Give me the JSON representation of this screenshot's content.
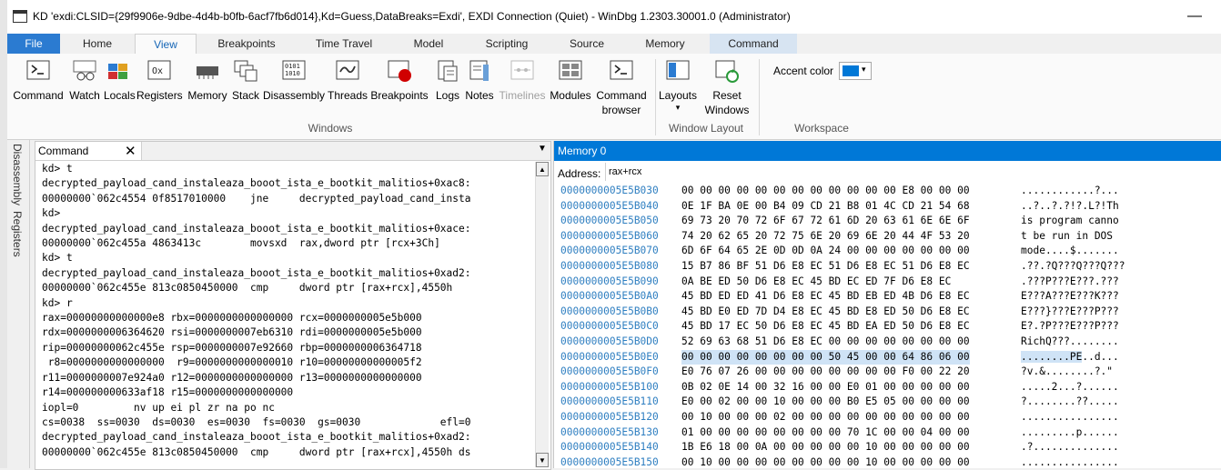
{
  "window": {
    "title": "KD 'exdi:CLSID={29f9906e-9dbe-4d4b-b0fb-6acf7fb6d014},Kd=Guess,DataBreaks=Exdi', EXDI Connection (Quiet) - WinDbg 1.2303.30001.0 (Administrator)",
    "minimize_glyph": "—"
  },
  "ribbon_tabs": [
    "File",
    "Home",
    "View",
    "Breakpoints",
    "Time Travel",
    "Model",
    "Scripting",
    "Source",
    "Memory",
    "Command"
  ],
  "ribbon": {
    "windows_buttons": [
      {
        "label": "Command",
        "icon": "command-window-icon"
      },
      {
        "label": "Watch",
        "icon": "watch-glasses-icon"
      },
      {
        "label": "Locals",
        "icon": "locals-blocks-icon"
      },
      {
        "label": "Registers",
        "icon": "registers-hex-icon"
      },
      {
        "label": "Memory",
        "icon": "memory-chip-icon"
      },
      {
        "label": "Stack",
        "icon": "stack-windows-icon"
      },
      {
        "label": "Disassembly",
        "icon": "disassembly-binary-icon"
      },
      {
        "label": "Threads",
        "icon": "threads-icon"
      },
      {
        "label": "Breakpoints",
        "icon": "breakpoint-red-dot-icon"
      },
      {
        "label": "Logs",
        "icon": "logs-icon"
      },
      {
        "label": "Notes",
        "icon": "notes-icon"
      },
      {
        "label": "Timelines",
        "icon": "timelines-icon"
      },
      {
        "label": "Modules",
        "icon": "modules-grid-icon"
      },
      {
        "label": "Command browser",
        "icon": "command-browser-icon"
      }
    ],
    "windows_group_label": "Windows",
    "layouts_label": "Layouts",
    "layouts_arrow": "▾",
    "reset_label": "Reset Windows",
    "window_layout_label": "Window Layout",
    "accent_label": "Accent color",
    "accent_color": "#0078d7",
    "accent_arrow": "▾",
    "workspace_label": "Workspace"
  },
  "side_tabs": [
    "Disassembly",
    "Registers"
  ],
  "command_pane": {
    "tab_label": "Command",
    "close_glyph": "✕",
    "menu_glyph": "▼",
    "lines": [
      "kd> t",
      "decrypted_payload_cand_instaleaza_booot_ista_e_bootkit_malitios+0xac8:",
      "00000000`062c4554 0f8517010000    jne     decrypted_payload_cand_insta",
      "kd>",
      "decrypted_payload_cand_instaleaza_booot_ista_e_bootkit_malitios+0xace:",
      "00000000`062c455a 4863413c        movsxd  rax,dword ptr [rcx+3Ch]",
      "kd> t",
      "decrypted_payload_cand_instaleaza_booot_ista_e_bootkit_malitios+0xad2:",
      "00000000`062c455e 813c0850450000  cmp     dword ptr [rax+rcx],4550h",
      "kd> r",
      "rax=00000000000000e8 rbx=0000000000000000 rcx=0000000005e5b000",
      "rdx=0000000006364620 rsi=0000000007eb6310 rdi=0000000005e5b000",
      "rip=00000000062c455e rsp=0000000007e92660 rbp=0000000006364718",
      " r8=0000000000000000  r9=0000000000000010 r10=00000000000005f2",
      "r11=0000000007e924a0 r12=0000000000000000 r13=0000000000000000",
      "r14=000000000633af18 r15=0000000000000000",
      "iopl=0         nv up ei pl zr na po nc",
      "cs=0038  ss=0030  ds=0030  es=0030  fs=0030  gs=0030             efl=0",
      "decrypted_payload_cand_instaleaza_booot_ista_e_bootkit_malitios+0xad2:",
      "00000000`062c455e 813c0850450000  cmp     dword ptr [rax+rcx],4550h ds"
    ],
    "scroll_up": "▲",
    "scroll_down": "▼"
  },
  "memory_pane": {
    "title": "Memory 0",
    "address_label": "Address:",
    "address_value": "rax+rcx",
    "rows": [
      {
        "addr": "0000000005E5B030",
        "bytes": "00 00 00 00 00 00 00 00 00 00 00 00 E8 00 00 00",
        "ascii": "............?..."
      },
      {
        "addr": "0000000005E5B040",
        "bytes": "0E 1F BA 0E 00 B4 09 CD 21 B8 01 4C CD 21 54 68",
        "ascii": "..?..?.?!?.L?!Th"
      },
      {
        "addr": "0000000005E5B050",
        "bytes": "69 73 20 70 72 6F 67 72 61 6D 20 63 61 6E 6E 6F",
        "ascii": "is program canno"
      },
      {
        "addr": "0000000005E5B060",
        "bytes": "74 20 62 65 20 72 75 6E 20 69 6E 20 44 4F 53 20",
        "ascii": "t be run in DOS "
      },
      {
        "addr": "0000000005E5B070",
        "bytes": "6D 6F 64 65 2E 0D 0D 0A 24 00 00 00 00 00 00 00",
        "ascii": "mode....$......."
      },
      {
        "addr": "0000000005E5B080",
        "bytes": "15 B7 86 BF 51 D6 E8 EC 51 D6 E8 EC 51 D6 E8 EC",
        "ascii": ".??.?Q???Q???Q???"
      },
      {
        "addr": "0000000005E5B090",
        "bytes": "0A BE ED 50 D6 E8 EC 45 BD EC ED 7F D6 E8 EC",
        "ascii": ".???P???E???.???"
      },
      {
        "addr": "0000000005E5B0A0",
        "bytes": "45 BD ED ED 41 D6 E8 EC 45 BD EB ED 4B D6 E8 EC",
        "ascii": "E???A???E???K???"
      },
      {
        "addr": "0000000005E5B0B0",
        "bytes": "45 BD E0 ED 7D D4 E8 EC 45 BD E8 ED 50 D6 E8 EC",
        "ascii": "E???}???E???P???"
      },
      {
        "addr": "0000000005E5B0C0",
        "bytes": "45 BD 17 EC 50 D6 E8 EC 45 BD EA ED 50 D6 E8 EC",
        "ascii": "E?.?P???E???P???"
      },
      {
        "addr": "0000000005E5B0D0",
        "bytes": "52 69 63 68 51 D6 E8 EC 00 00 00 00 00 00 00 00",
        "ascii": "RichQ???........"
      },
      {
        "addr": "0000000005E5B0E0",
        "bytes": "00 00 00 00 00 00 00 00 50 45 00 00 64 86 06 00",
        "ascii_sel": "........PE",
        "ascii_rest": "..d...",
        "highlight": true
      },
      {
        "addr": "0000000005E5B0F0",
        "bytes": "E0 76 07 26 00 00 00 00 00 00 00 00 F0 00 22 20",
        "ascii": "?v.&........?.\""
      },
      {
        "addr": "0000000005E5B100",
        "bytes": "0B 02 0E 14 00 32 16 00 00 E0 01 00 00 00 00 00",
        "ascii": ".....2...?......"
      },
      {
        "addr": "0000000005E5B110",
        "bytes": "E0 00 02 00 00 10 00 00 00 B0 E5 05 00 00 00 00",
        "ascii": "?........??....."
      },
      {
        "addr": "0000000005E5B120",
        "bytes": "00 10 00 00 00 02 00 00 00 00 00 00 00 00 00 00",
        "ascii": "................"
      },
      {
        "addr": "0000000005E5B130",
        "bytes": "01 00 00 00 00 00 00 00 00 70 1C 00 00 04 00 00",
        "ascii": ".........p......"
      },
      {
        "addr": "0000000005E5B140",
        "bytes": "1B E6 18 00 0A 00 00 00 00 00 10 00 00 00 00 00",
        "ascii": ".?.............."
      },
      {
        "addr": "0000000005E5B150",
        "bytes": "00 10 00 00 00 00 00 00 00 00 10 00 00 00 00 00",
        "ascii": "................"
      }
    ]
  }
}
